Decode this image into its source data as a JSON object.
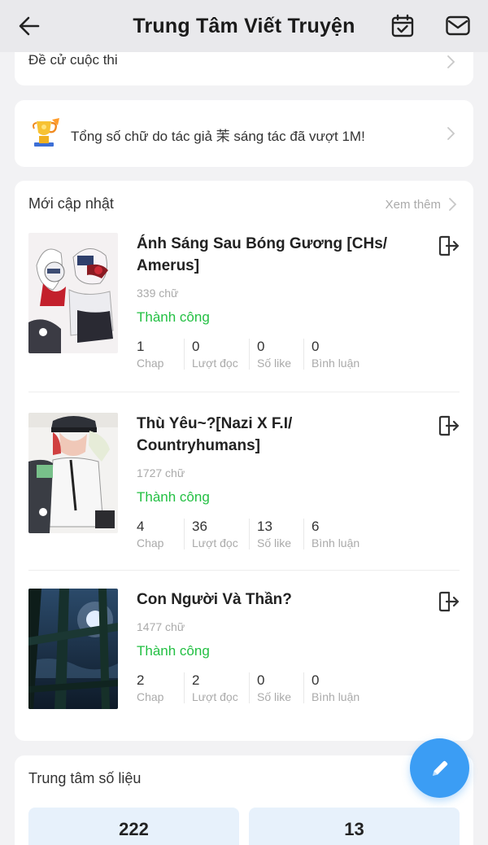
{
  "header": {
    "title": "Trung Tâm Viết Truyện",
    "icons": [
      "back-arrow-icon",
      "calendar-check-icon",
      "mail-icon"
    ]
  },
  "contest": {
    "label": "Đề cử cuộc thi"
  },
  "notice": {
    "text": "Tổng số chữ do tác giả 茉 sáng tác đã vượt 1M!",
    "icon": "trophy-icon"
  },
  "updates": {
    "heading": "Mới cập nhật",
    "more_label": "Xem thêm",
    "stat_labels": {
      "chap": "Chap",
      "reads": "Lượt đọc",
      "likes": "Số like",
      "comments": "Bình luận"
    },
    "stories": [
      {
        "title": "Ánh Sáng Sau Bóng Gương [CHs/ Amerus]",
        "words": "339 chữ",
        "status": "Thành công",
        "chap": "1",
        "reads": "0",
        "likes": "0",
        "comments": "0"
      },
      {
        "title": "Thù Yêu~?[Nazi X F.I/ Countryhumans]",
        "words": "1727 chữ",
        "status": "Thành công",
        "chap": "4",
        "reads": "36",
        "likes": "13",
        "comments": "6"
      },
      {
        "title": "Con Người Và Thần?",
        "words": "1477 chữ",
        "status": "Thành công",
        "chap": "2",
        "reads": "2",
        "likes": "0",
        "comments": "0"
      }
    ]
  },
  "data_center": {
    "heading": "Trung tâm số liệu",
    "metrics": [
      "222",
      "13"
    ]
  },
  "colors": {
    "accent": "#3b9df4",
    "success": "#23c043",
    "header_bg": "#e9e9ec"
  }
}
